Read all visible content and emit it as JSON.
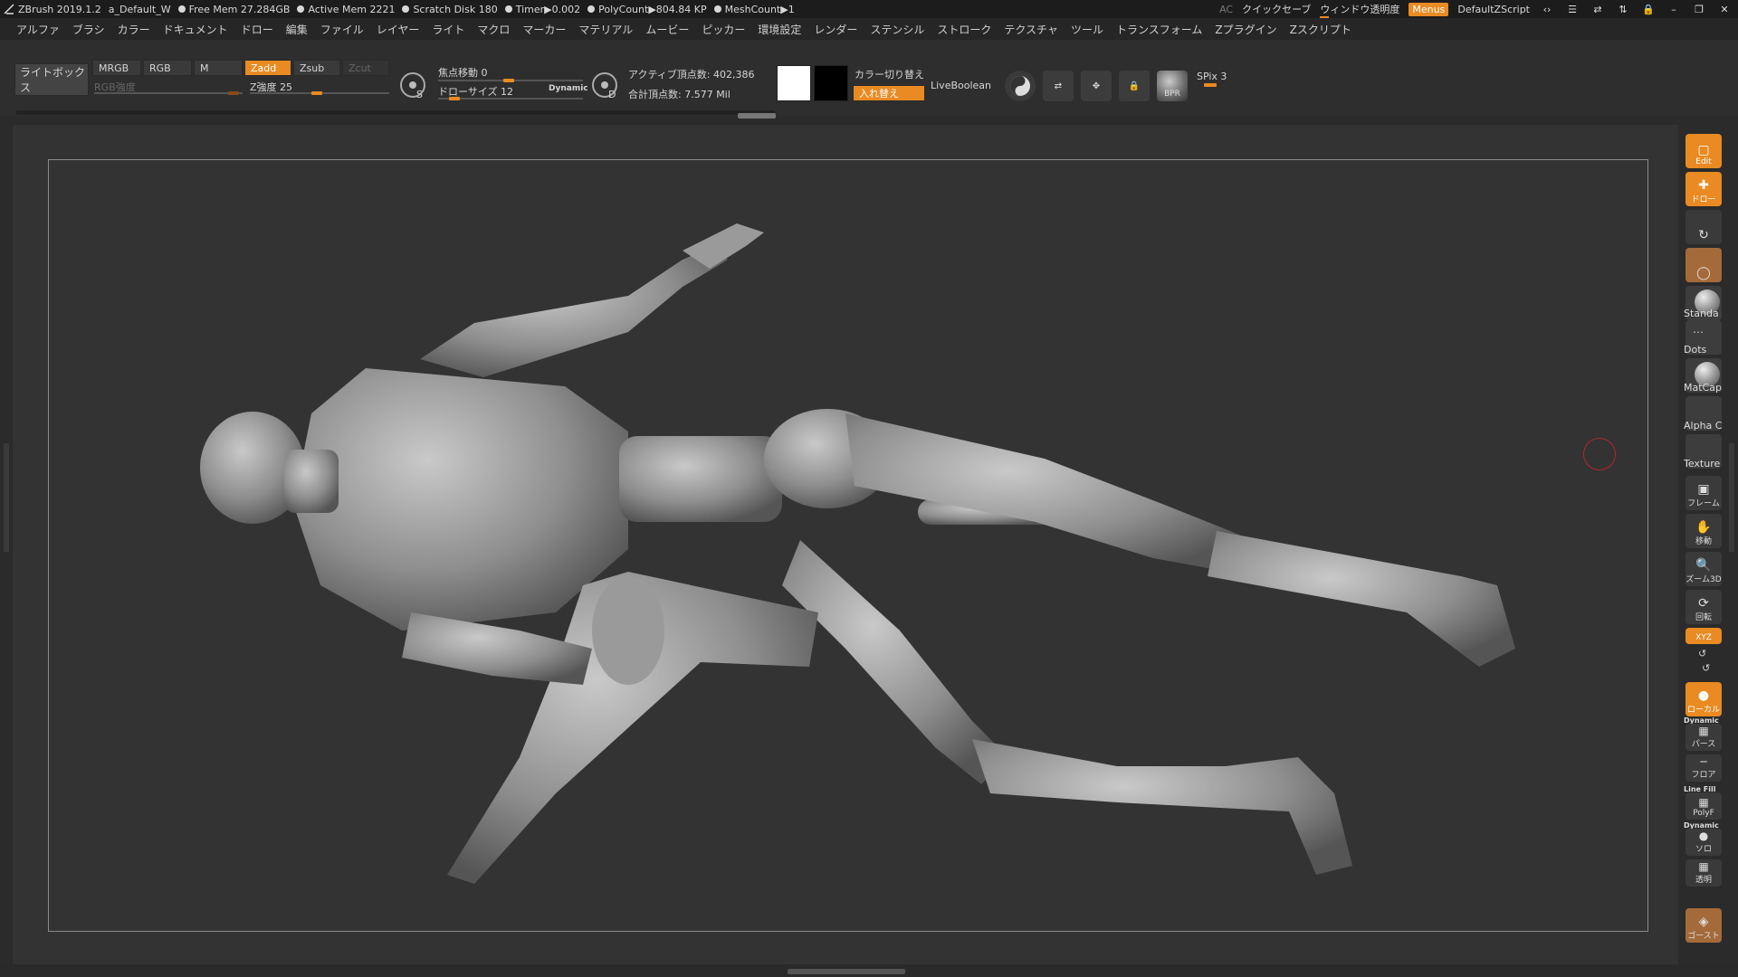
{
  "topbar": {
    "app_title": "ZBrush 2019.1.2",
    "doc_name": "a_Default_W",
    "free_mem": "Free Mem 27.284GB",
    "active_mem": "Active Mem 2221",
    "scratch_disk": "Scratch Disk 180",
    "timer": "Timer▶0.002",
    "polycount": "PolyCount▶804.84 KP",
    "meshcount": "MeshCount▶1",
    "ac": "AC",
    "quicksave": "クイックセーブ",
    "window_transparency": "ウィンドウ透明度",
    "menus": "Menus",
    "default_zscript": "DefaultZScript"
  },
  "menubar": {
    "items": [
      "アルファ",
      "ブラシ",
      "カラー",
      "ドキュメント",
      "ドロー",
      "編集",
      "ファイル",
      "レイヤー",
      "ライト",
      "マクロ",
      "マーカー",
      "マテリアル",
      "ムービー",
      "ピッカー",
      "環境設定",
      "レンダー",
      "ステンシル",
      "ストローク",
      "テクスチャ",
      "ツール",
      "トランスフォーム",
      "Zプラグイン",
      "Zスクリプト"
    ]
  },
  "shelf": {
    "lightbox": "ライトボックス",
    "mrgb": "MRGB",
    "rgb": "RGB",
    "m": "M",
    "zadd": "Zadd",
    "zsub": "Zsub",
    "zcut": "Zcut",
    "rgb_intensity": "RGB強度",
    "z_intensity": "Z強度 25",
    "focal_shift": "焦点移動 0",
    "draw_size": "ドローサイズ 12",
    "dynamic": "Dynamic",
    "active_points": "アクティブ頂点数: 402,386",
    "total_points": "合計頂点数: 7.577 Mil",
    "color_switch": "カラー切り替え",
    "swap": "入れ替え",
    "live_boolean": "LiveBoolean",
    "spix": "SPix 3",
    "s_label": "S",
    "d_label": "D",
    "bpr": "BPR",
    "primary_color": "#ffffff",
    "secondary_color": "#000000",
    "accent_color": "#e98a22"
  },
  "right_shelf": {
    "edit": "Edit",
    "draw": "ドロー",
    "standard": "Standa",
    "dots": "Dots",
    "matcap": "MatCap",
    "alpha": "Alpha C",
    "texture": "Texture",
    "frame": "フレーム",
    "move": "移動",
    "zoom3d": "ズーム3D",
    "rotate": "回転",
    "xyz": "XYZ",
    "local": "ローカル",
    "dynamic_persp": "Dynamic",
    "persp": "パース",
    "floor": "フロア",
    "line_fill": "Line Fill",
    "polyf": "PolyF",
    "dynamic_solo": "Dynamic",
    "solo": "ソロ",
    "transp": "透明",
    "ghost": "ゴースト"
  }
}
